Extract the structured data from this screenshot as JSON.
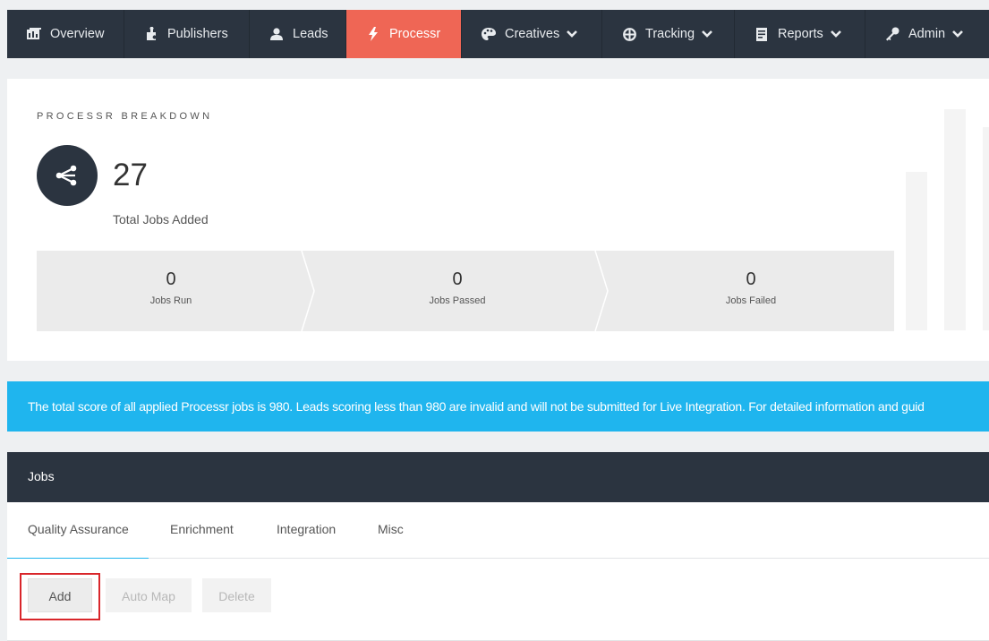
{
  "nav": {
    "items": [
      {
        "label": "Overview",
        "icon": "bar-chart-icon",
        "has_caret": false,
        "active": false
      },
      {
        "label": "Publishers",
        "icon": "puzzle-icon",
        "has_caret": false,
        "active": false
      },
      {
        "label": "Leads",
        "icon": "user-icon",
        "has_caret": false,
        "active": false
      },
      {
        "label": "Processr",
        "icon": "bolt-icon",
        "has_caret": false,
        "active": true
      },
      {
        "label": "Creatives",
        "icon": "palette-icon",
        "has_caret": true,
        "active": false
      },
      {
        "label": "Tracking",
        "icon": "crosshair-icon",
        "has_caret": true,
        "active": false
      },
      {
        "label": "Reports",
        "icon": "document-icon",
        "has_caret": true,
        "active": false
      },
      {
        "label": "Admin",
        "icon": "key-icon",
        "has_caret": true,
        "active": false
      }
    ]
  },
  "breakdown": {
    "title": "PROCESSR BREAKDOWN",
    "icon": "share-icon",
    "total": "27",
    "total_label": "Total Jobs Added",
    "stats": [
      {
        "value": "0",
        "label": "Jobs Run"
      },
      {
        "value": "0",
        "label": "Jobs Passed"
      },
      {
        "value": "0",
        "label": "Jobs Failed"
      }
    ]
  },
  "banner": {
    "text": "The total score of all applied Processr jobs is 980. Leads scoring less than 980 are invalid and will not be submitted for Live Integration. For detailed information and guid"
  },
  "jobs": {
    "title": "Jobs",
    "tabs": [
      "Quality Assurance",
      "Enrichment",
      "Integration",
      "Misc"
    ],
    "active_tab": "Quality Assurance",
    "buttons": {
      "add": "Add",
      "auto_map": "Auto Map",
      "delete": "Delete"
    }
  },
  "colors": {
    "nav_bg": "#2b3440",
    "active": "#ef6655",
    "banner": "#1fb5ee",
    "highlight": "#d9262b"
  }
}
